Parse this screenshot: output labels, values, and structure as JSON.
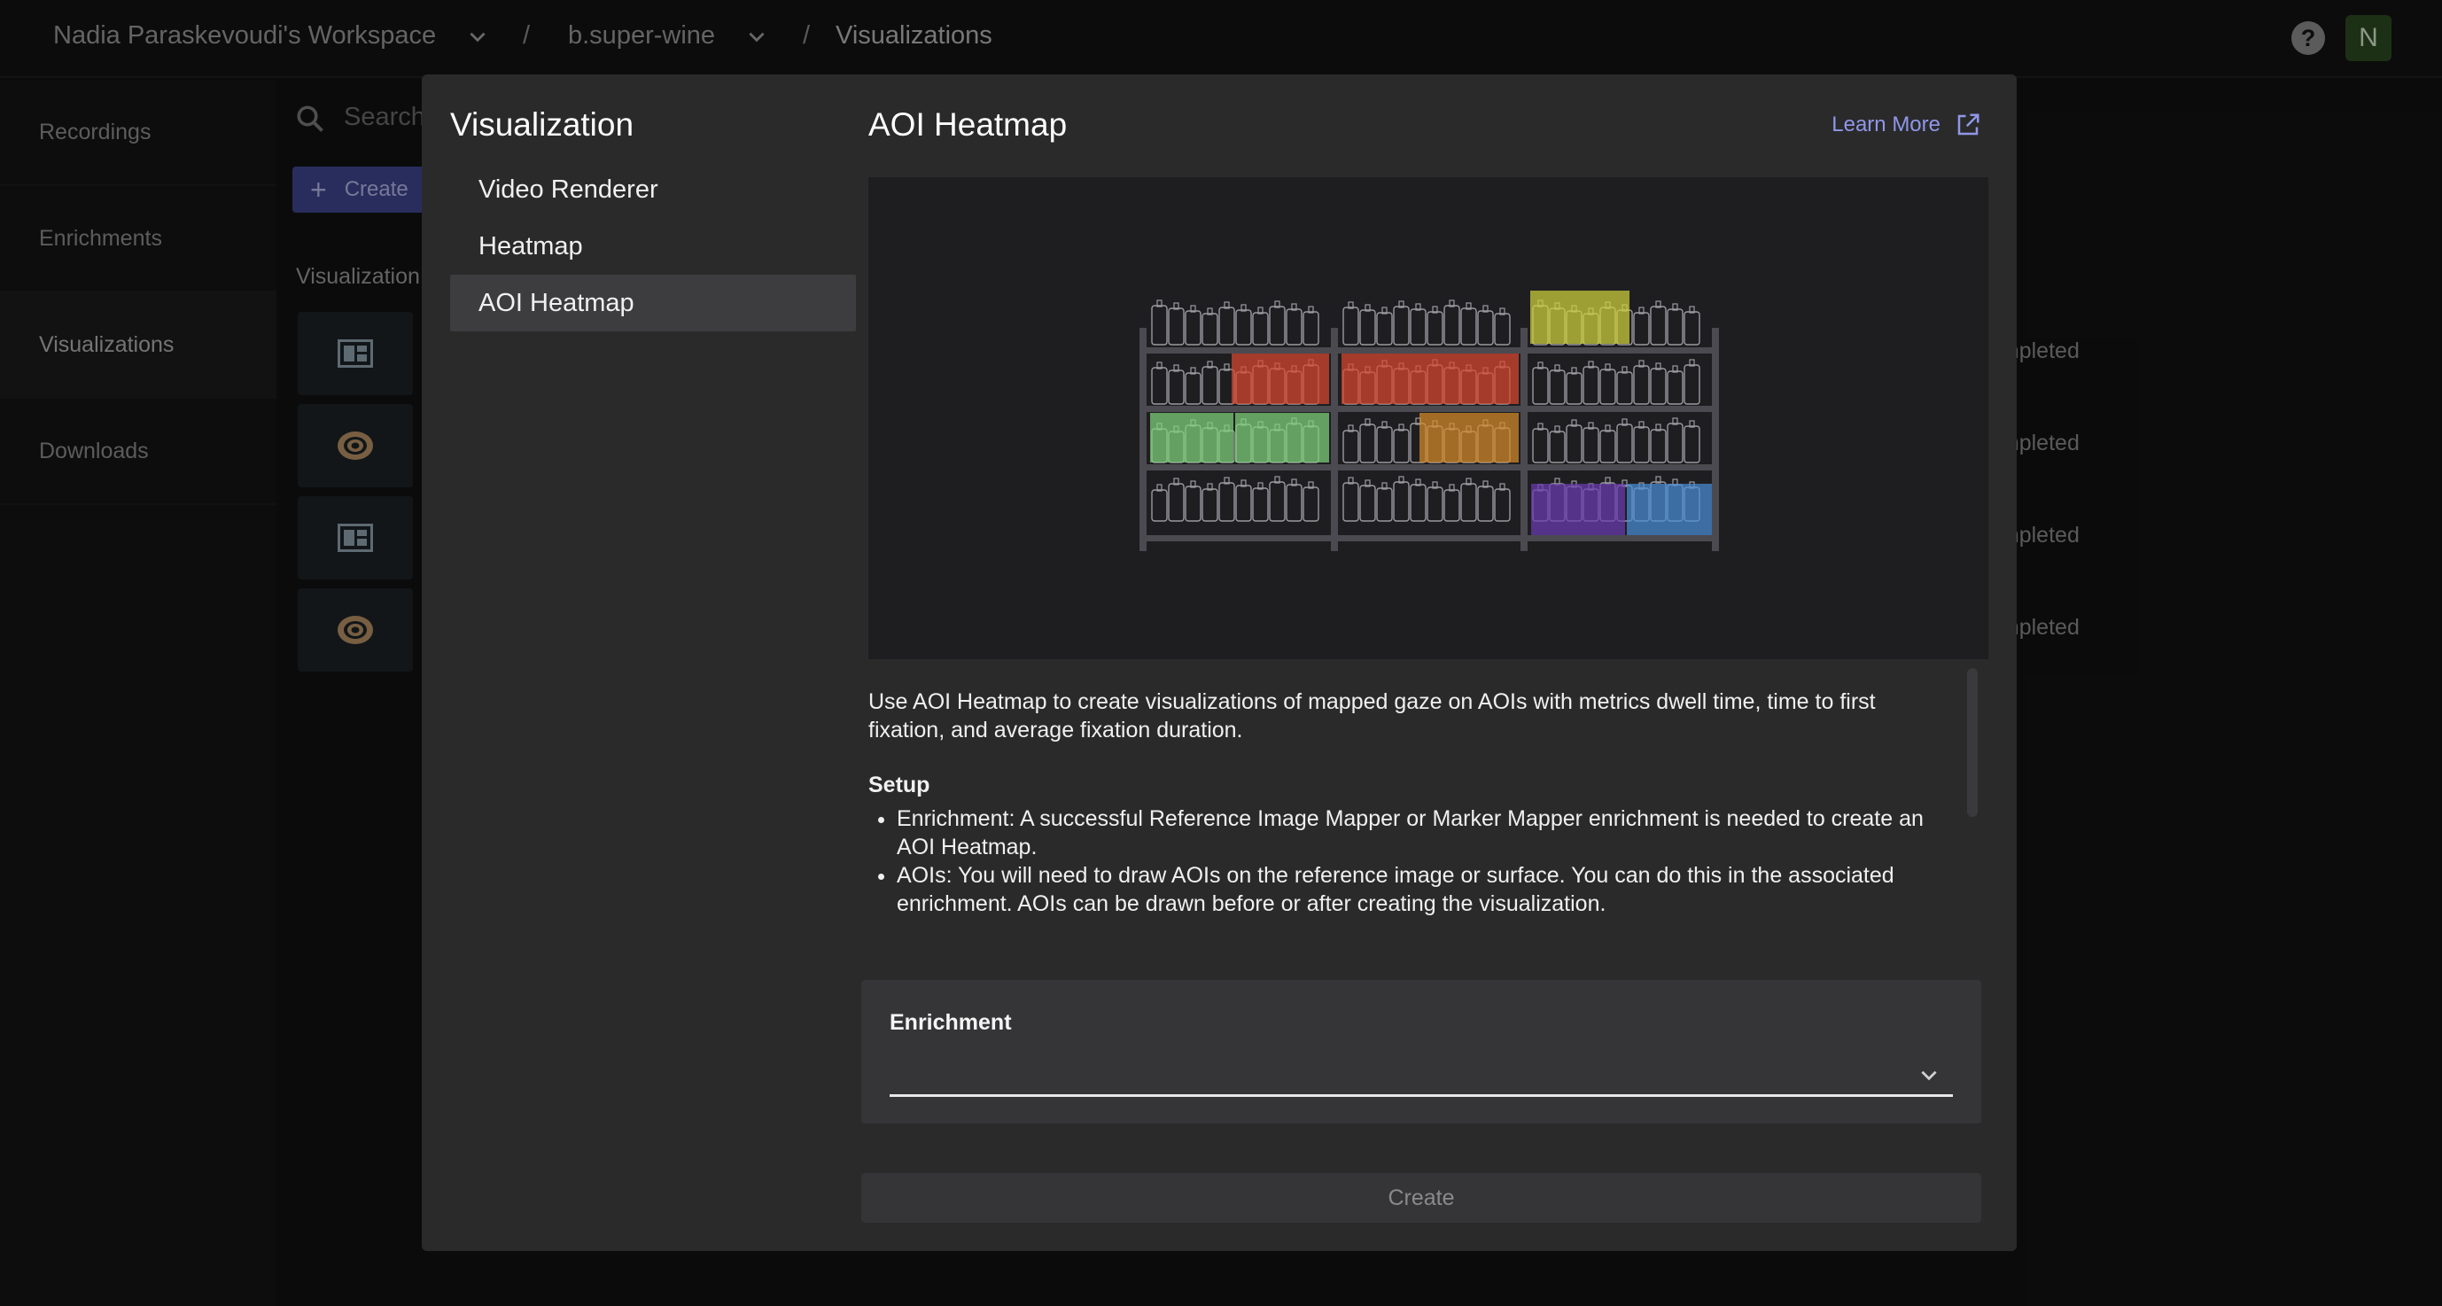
{
  "topbar": {
    "workspace": "Nadia Paraskevoudi's Workspace",
    "project": "b.super-wine",
    "section": "Visualizations",
    "separator": "/",
    "avatar_initial": "N",
    "help_glyph": "?"
  },
  "sidebar": {
    "items": [
      {
        "label": "Recordings",
        "active": false
      },
      {
        "label": "Enrichments",
        "active": false
      },
      {
        "label": "Visualizations",
        "active": true
      },
      {
        "label": "Downloads",
        "active": false
      }
    ]
  },
  "background": {
    "search_placeholder": "Search",
    "create_label": "Create",
    "list_header": "Visualization",
    "rows": [
      {
        "icon": "dashboard-icon",
        "status": "ompleted"
      },
      {
        "icon": "heatmap-icon",
        "status": "ompleted"
      },
      {
        "icon": "dashboard-icon",
        "status": "ompleted"
      },
      {
        "icon": "heatmap-icon",
        "status": "ompleted"
      }
    ]
  },
  "modal": {
    "title": "Visualization",
    "options": [
      {
        "label": "Video Renderer",
        "selected": false
      },
      {
        "label": "Heatmap",
        "selected": false
      },
      {
        "label": "AOI Heatmap",
        "selected": true
      }
    ],
    "detail": {
      "title": "AOI Heatmap",
      "learn_more": "Learn More",
      "description": "Use AOI Heatmap to create visualizations of mapped gaze on AOIs with metrics dwell time, time to first fixation, and average fixation duration.",
      "setup_heading": "Setup",
      "setup_items": [
        "Enrichment: A successful Reference Image Mapper or Marker Mapper enrichment is needed to create an AOI Heatmap.",
        "AOIs: You will need to draw AOIs on the reference image or surface. You can do this in the associated enrichment. AOIs can be drawn before or after creating the visualization."
      ]
    },
    "enrichment_label": "Enrichment",
    "enrichment_value": "",
    "create_label": "Create"
  },
  "colors": {
    "accent": "#8f97e8",
    "create_bg": "#3f4590",
    "modal_bg": "#2a2a2b",
    "aoi_yellow": "#cfd13c",
    "aoi_red": "#d9472e",
    "aoi_green": "#7fd37a",
    "aoi_orange": "#d68a2a",
    "aoi_purple": "#6a3bb0",
    "aoi_blue": "#4a8ed6"
  }
}
